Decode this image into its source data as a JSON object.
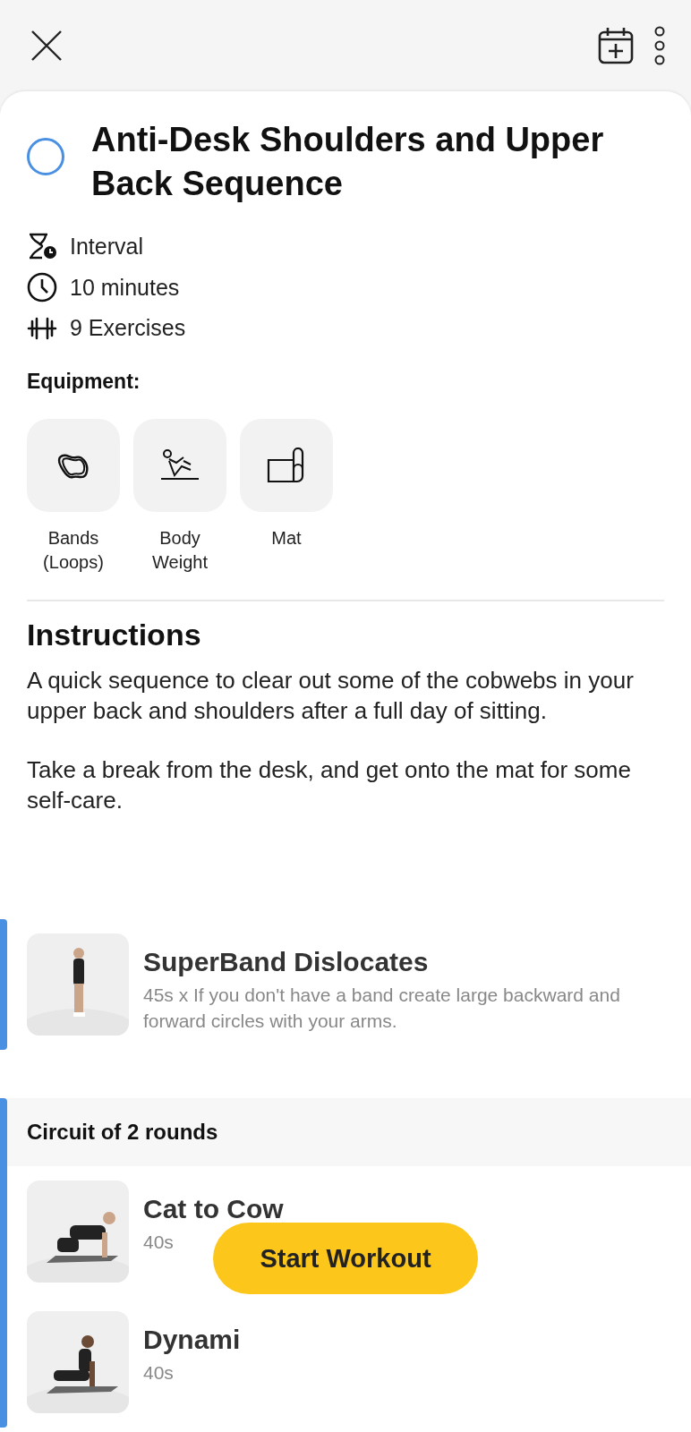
{
  "workout": {
    "title": "Anti-Desk Shoulders and Upper Back Sequence",
    "completed": false,
    "meta": [
      {
        "kind": "type",
        "text": "Interval"
      },
      {
        "kind": "duration",
        "text": "10 minutes"
      },
      {
        "kind": "count",
        "text": "9 Exercises"
      }
    ]
  },
  "equipment": {
    "label": "Equipment:",
    "items": [
      {
        "kind": "bands",
        "name": "Bands\n(Loops)"
      },
      {
        "kind": "bodyweight",
        "name": "Body\nWeight"
      },
      {
        "kind": "mat",
        "name": "Mat"
      }
    ]
  },
  "instructions": {
    "heading": "Instructions",
    "paragraphs": [
      "A quick sequence to clear out some of the cobwebs in your upper back and shoulders after a full day of sitting.",
      "Take a break from the desk, and get onto the mat for some self-care."
    ]
  },
  "blocks": [
    {
      "kind": "single",
      "exercises": [
        {
          "kind": "exercise",
          "name": "SuperBand Dislocates",
          "detail": "45s x If you don't have a band create large backward and forward circles with your arms."
        }
      ]
    },
    {
      "kind": "circuit",
      "title": "Circuit of 2 rounds",
      "exercises": [
        {
          "kind": "exercise",
          "name": "Cat to Cow",
          "detail": "40s"
        },
        {
          "kind": "exercise",
          "name": "Dynami",
          "detail": "40s"
        }
      ]
    }
  ],
  "start_button": "Start Workout"
}
